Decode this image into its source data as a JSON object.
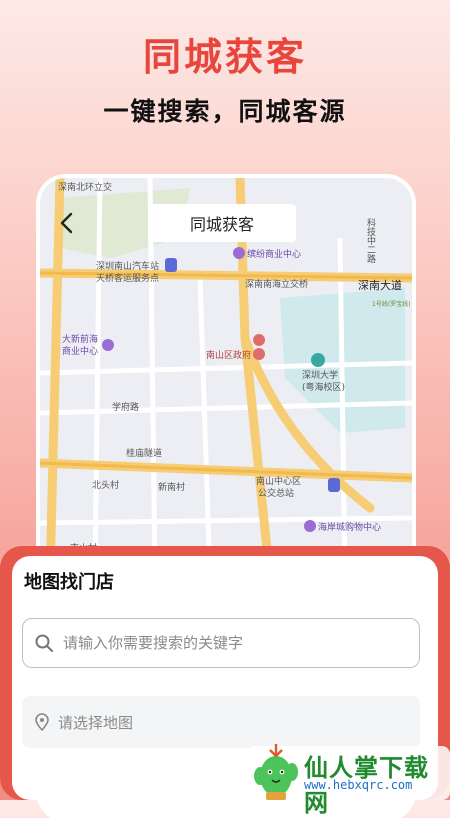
{
  "hero": {
    "title": "同城获客",
    "subtitle": "一键搜索，同城客源"
  },
  "phone": {
    "nav_title": "同城获客",
    "back_icon": "chevron-left-icon",
    "map_labels": {
      "north_ring": "深南北环立交",
      "bus_station_1": "深圳南山汽车站",
      "bus_station_2": "天桥客运服务点",
      "mall": "缤纷商业中心",
      "keji": "科技中二路",
      "shennan_interchange": "深南南海立交桥",
      "shennan_road": "深南大道",
      "metro": "1号线(罗宝线)",
      "qianhai_1": "大新前海",
      "qianhai_2": "商业中心",
      "gov": "南山区政府",
      "szu_1": "深圳大学",
      "szu_2": "(粤海校区)",
      "xuefu": "学府路",
      "guimiao": "桂庙隧道",
      "beitou": "北头村",
      "xinnan": "新南村",
      "nanshan_center_1": "南山中心区",
      "nanshan_center_2": "公交总站",
      "coastal": "海岸城购物中心",
      "nanshan_village": "南山村"
    }
  },
  "sheet": {
    "title": "地图找门店",
    "search_placeholder": "请输入你需要搜索的关键字",
    "search_icon": "search-icon",
    "map_select_label": "请选择地图",
    "map_select_icon": "location-pin-icon"
  },
  "watermark": {
    "name": "仙人掌下载网",
    "url": "www.hebxqrc.com"
  },
  "colors": {
    "accent": "#e8453c",
    "sheet_border": "#e5564b",
    "map_bg": "#eef0f5",
    "road_major": "#f7d27a",
    "water": "#bfe3ea"
  }
}
